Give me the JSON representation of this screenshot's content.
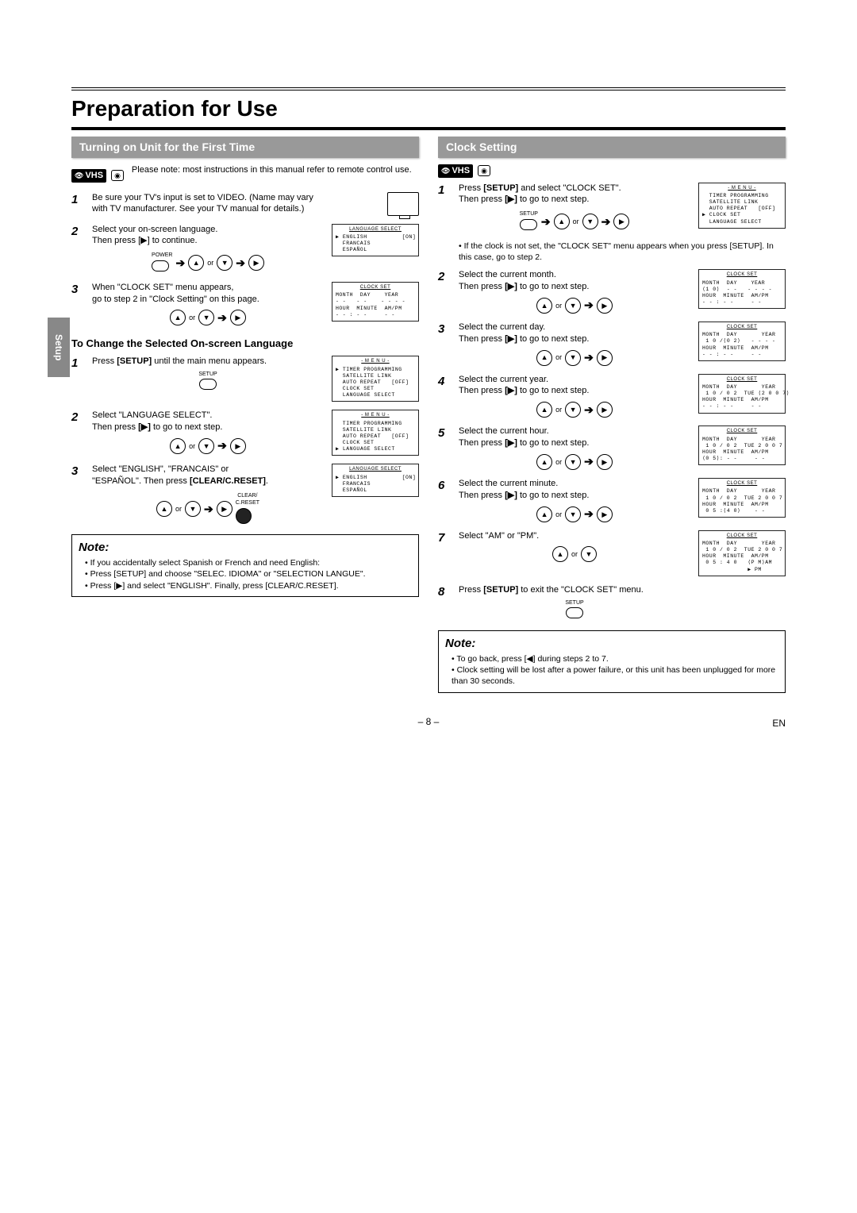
{
  "sidebar_tab": "Setup",
  "page_title": "Preparation for Use",
  "left": {
    "header1": "Turning on Unit for the First Time",
    "vhs": "VHS",
    "intro": "Please note: most instructions in this manual refer to remote control use.",
    "steps": [
      {
        "n": "1",
        "text": "Be sure your TV's input is set to VIDEO. (Name may vary with TV manufacturer. See your TV manual for details.)"
      },
      {
        "n": "2",
        "text": "Select your on-screen language.\nThen press [▶] to continue.",
        "btn_label": "POWER",
        "osd_title": "LANGUAGE SELECT",
        "osd_lines": [
          "▶ ENGLISH          [ON]",
          "  FRANCAIS",
          "  ESPAÑOL"
        ]
      },
      {
        "n": "3",
        "text": "When \"CLOCK SET\" menu appears,\ngo to step 2 in \"Clock Setting\" on this page.",
        "osd_title": "CLOCK SET",
        "osd_lines": [
          "MONTH  DAY    YEAR",
          "- -   - -    - - - -",
          "HOUR  MINUTE  AM/PM",
          "- - : - -     - -"
        ]
      }
    ],
    "header2": "To Change the Selected On-screen Language",
    "steps2": [
      {
        "n": "1",
        "text_html": "Press <b>[SETUP]</b> until the main menu appears.",
        "btn_label": "SETUP",
        "osd_title": "- M E N U -",
        "osd_lines": [
          "▶ TIMER PROGRAMMING",
          "  SATELLITE LINK",
          "  AUTO REPEAT   [OFF]",
          "  CLOCK SET",
          "  LANGUAGE SELECT"
        ]
      },
      {
        "n": "2",
        "text_html": "Select \"LANGUAGE SELECT\".\nThen press <b>[▶]</b> to go to next step.",
        "osd_title": "- M E N U -",
        "osd_lines": [
          "  TIMER PROGRAMMING",
          "  SATELLITE LINK",
          "  AUTO REPEAT   [OFF]",
          "  CLOCK SET",
          "▶ LANGUAGE SELECT"
        ]
      },
      {
        "n": "3",
        "text_html": "Select \"ENGLISH\", \"FRANCAIS\" or\n\"ESPAÑOL\". Then press <b>[CLEAR/C.RESET]</b>.",
        "btn_label": "CLEAR/\nC.RESET",
        "osd_title": "LANGUAGE SELECT",
        "osd_lines": [
          "▶ ENGLISH          [ON]",
          "  FRANCAIS",
          "  ESPAÑOL"
        ]
      }
    ],
    "note_title": "Note:",
    "note_lines": [
      "If you accidentally select Spanish or French and need English:",
      "Press [SETUP] and choose \"SELEC. IDIOMA\" or \"SELECTION LANGUE\".",
      "Press [▶] and select \"ENGLISH\". Finally, press [CLEAR/C.RESET]."
    ]
  },
  "right": {
    "header": "Clock Setting",
    "vhs": "VHS",
    "steps": [
      {
        "n": "1",
        "text_html": "Press <b>[SETUP]</b> and select \"CLOCK SET\".\nThen press <b>[▶]</b> to go to next step.",
        "btn_label": "SETUP",
        "osd_title": "- M E N U -",
        "osd_lines": [
          "  TIMER PROGRAMMING",
          "  SATELLITE LINK",
          "  AUTO REPEAT   [OFF]",
          "▶ CLOCK SET",
          "  LANGUAGE SELECT"
        ],
        "post_note": "• If the clock is not set, the \"CLOCK SET\" menu appears when you press [SETUP]. In this case, go to step 2."
      },
      {
        "n": "2",
        "text_html": "Select the current month.\nThen press <b>[▶]</b> to go to next step.",
        "osd_title": "CLOCK SET",
        "osd_lines": [
          "MONTH  DAY    YEAR",
          "⟨1 0⟩  - -   - - - -",
          "HOUR  MINUTE  AM/PM",
          "- - : - -     - -"
        ]
      },
      {
        "n": "3",
        "text_html": "Select the current day.\nThen press <b>[▶]</b> to go to next step.",
        "osd_title": "CLOCK SET",
        "osd_lines": [
          "MONTH  DAY       YEAR",
          " 1 0 /⟨0 2⟩   - - - -",
          "HOUR  MINUTE  AM/PM",
          "- - : - -     - -"
        ]
      },
      {
        "n": "4",
        "text_html": "Select the current year.\nThen press <b>[▶]</b> to go to next step.",
        "osd_title": "CLOCK SET",
        "osd_lines": [
          "MONTH  DAY       YEAR",
          " 1 0 / 0 2  TUE ⟨2 0 0 7⟩",
          "HOUR  MINUTE  AM/PM",
          "- - : - -     - -"
        ]
      },
      {
        "n": "5",
        "text_html": "Select the current hour.\nThen press <b>[▶]</b> to go to next step.",
        "osd_title": "CLOCK SET",
        "osd_lines": [
          "MONTH  DAY       YEAR",
          " 1 0 / 0 2  TUE 2 0 0 7",
          "HOUR  MINUTE  AM/PM",
          "⟨0 5⟩: - -     - -"
        ]
      },
      {
        "n": "6",
        "text_html": "Select the current minute.\nThen press <b>[▶]</b> to go to next step.",
        "osd_title": "CLOCK SET",
        "osd_lines": [
          "MONTH  DAY       YEAR",
          " 1 0 / 0 2  TUE 2 0 0 7",
          "HOUR  MINUTE  AM/PM",
          " 0 5 :⟨4 0⟩    - -"
        ]
      },
      {
        "n": "7",
        "text_html": "Select \"AM\" or \"PM\".",
        "simple_btns": true,
        "osd_title": "CLOCK SET",
        "osd_lines": [
          "MONTH  DAY       YEAR",
          " 1 0 / 0 2  TUE 2 0 0 7",
          "HOUR  MINUTE  AM/PM",
          " 0 5 : 4 0   ⟨P M⟩AM",
          "             ▶ PM"
        ]
      },
      {
        "n": "8",
        "text_html": "Press <b>[SETUP]</b> to exit the \"CLOCK SET\" menu.",
        "btn_label": "SETUP",
        "no_osd": true
      }
    ],
    "note_title": "Note:",
    "note_lines": [
      "To go back, press [◀] during steps 2 to 7.",
      "Clock setting will be lost after a power failure, or this unit has been unplugged for more than 30 seconds."
    ]
  },
  "page_num": "– 8 –",
  "lang": "EN"
}
